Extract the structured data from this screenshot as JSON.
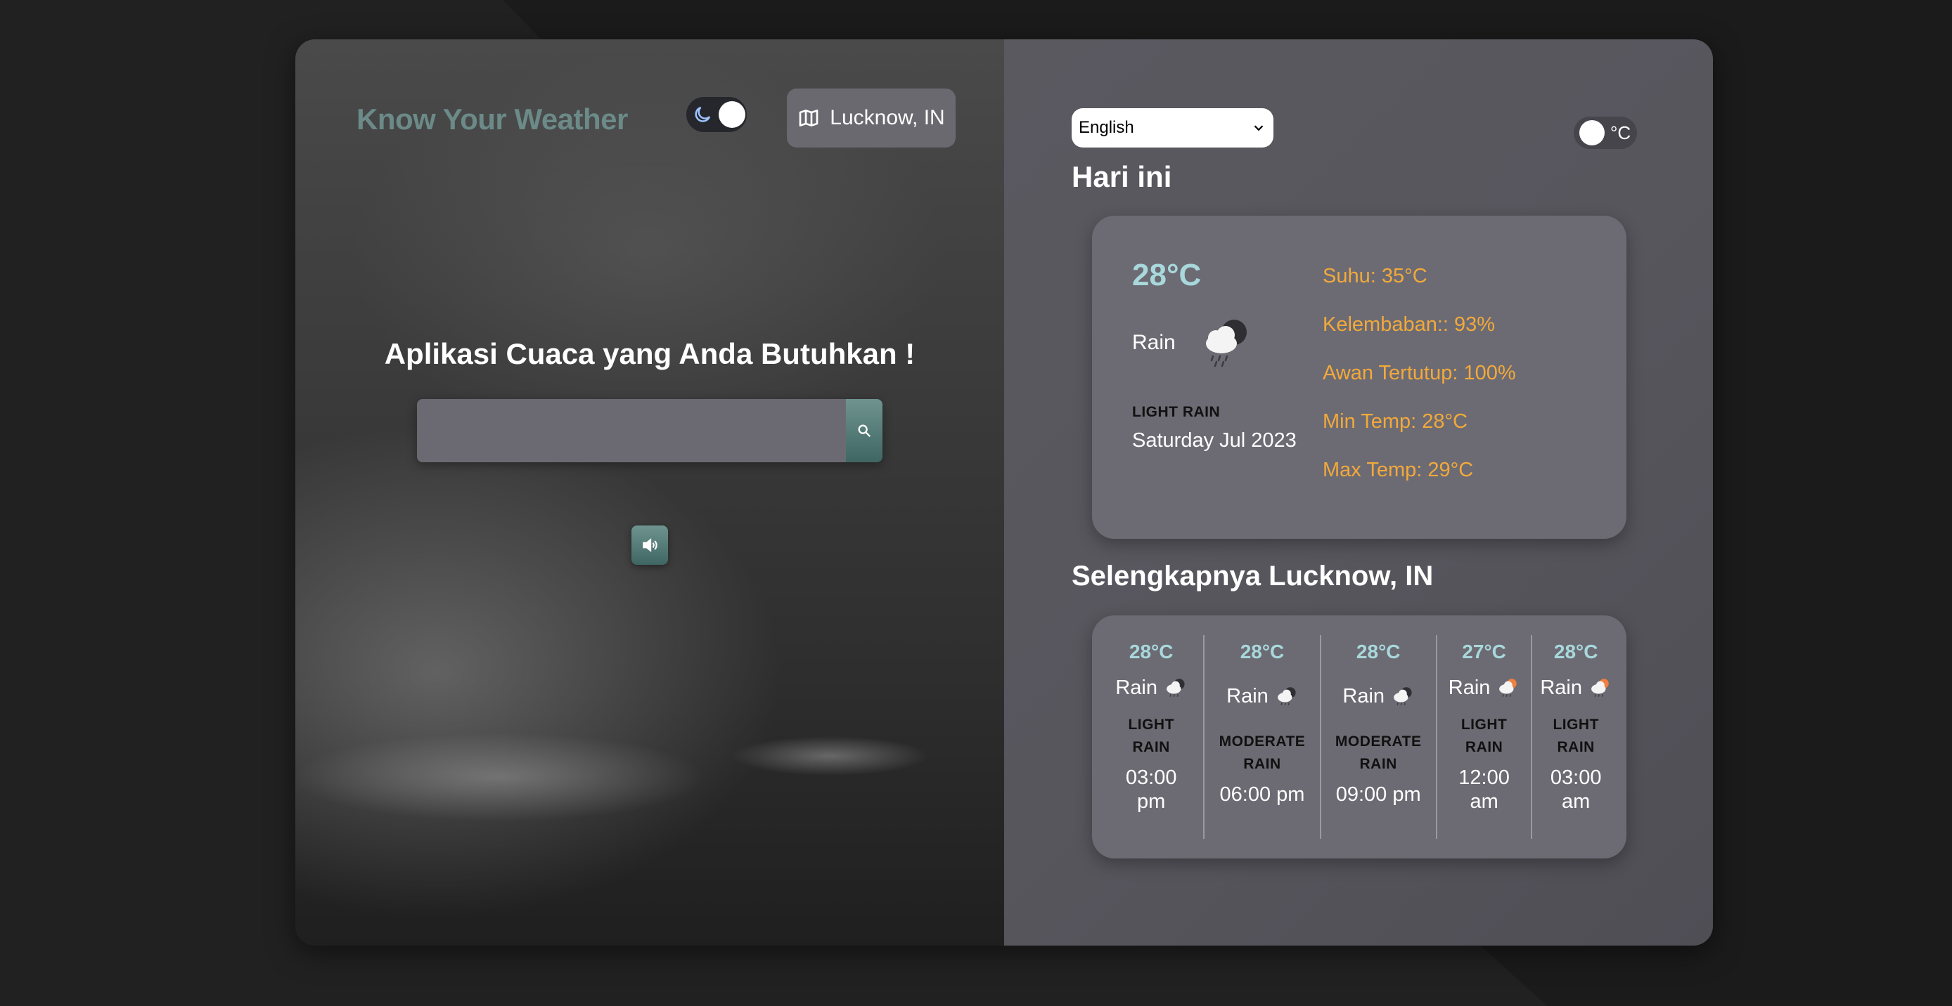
{
  "header": {
    "brand": "Know Your Weather",
    "location_button": "Lucknow, IN"
  },
  "hero": {
    "tagline": "Aplikasi Cuaca yang Anda Butuhkan !",
    "search_value": ""
  },
  "settings": {
    "language": "English",
    "unit_label": "°C"
  },
  "today": {
    "heading": "Hari ini",
    "temp": "28°C",
    "condition": "Rain",
    "description": "LIGHT RAIN",
    "date": "Saturday Jul 2023",
    "details": [
      "Suhu: 35°C",
      "Kelembaban:: 93%",
      "Awan Tertutup: 100%",
      "Min Temp: 28°C",
      "Max Temp: 29°C"
    ]
  },
  "forecast": {
    "heading": "Selengkapnya Lucknow, IN",
    "items": [
      {
        "temp": "28°C",
        "condition": "Rain",
        "desc_line1": "LIGHT",
        "desc_line2": "RAIN",
        "time_line1": "03:00",
        "time_line2": "pm"
      },
      {
        "temp": "28°C",
        "condition": "Rain",
        "desc_line1": "MODERATE",
        "desc_line2": "RAIN",
        "time_line1": "06:00 pm",
        "time_line2": ""
      },
      {
        "temp": "28°C",
        "condition": "Rain",
        "desc_line1": "MODERATE",
        "desc_line2": "RAIN",
        "time_line1": "09:00 pm",
        "time_line2": ""
      },
      {
        "temp": "27°C",
        "condition": "Rain",
        "desc_line1": "LIGHT",
        "desc_line2": "RAIN",
        "time_line1": "12:00",
        "time_line2": "am"
      },
      {
        "temp": "28°C",
        "condition": "Rain",
        "desc_line1": "LIGHT",
        "desc_line2": "RAIN",
        "time_line1": "03:00",
        "time_line2": "am"
      }
    ]
  },
  "icons": {
    "theme": "moon-icon",
    "location": "map-icon",
    "search": "search-icon",
    "voice": "speaker-icon",
    "weather_night": "cloud-moon-rain-icon",
    "weather_day": "cloud-sun-rain-icon"
  },
  "colors": {
    "accent_temp": "#a8d8dc",
    "detail_text": "#f2a93b",
    "brand": "#6b8a88",
    "card": "#6c6b73",
    "button_teal": "#4f7673"
  }
}
